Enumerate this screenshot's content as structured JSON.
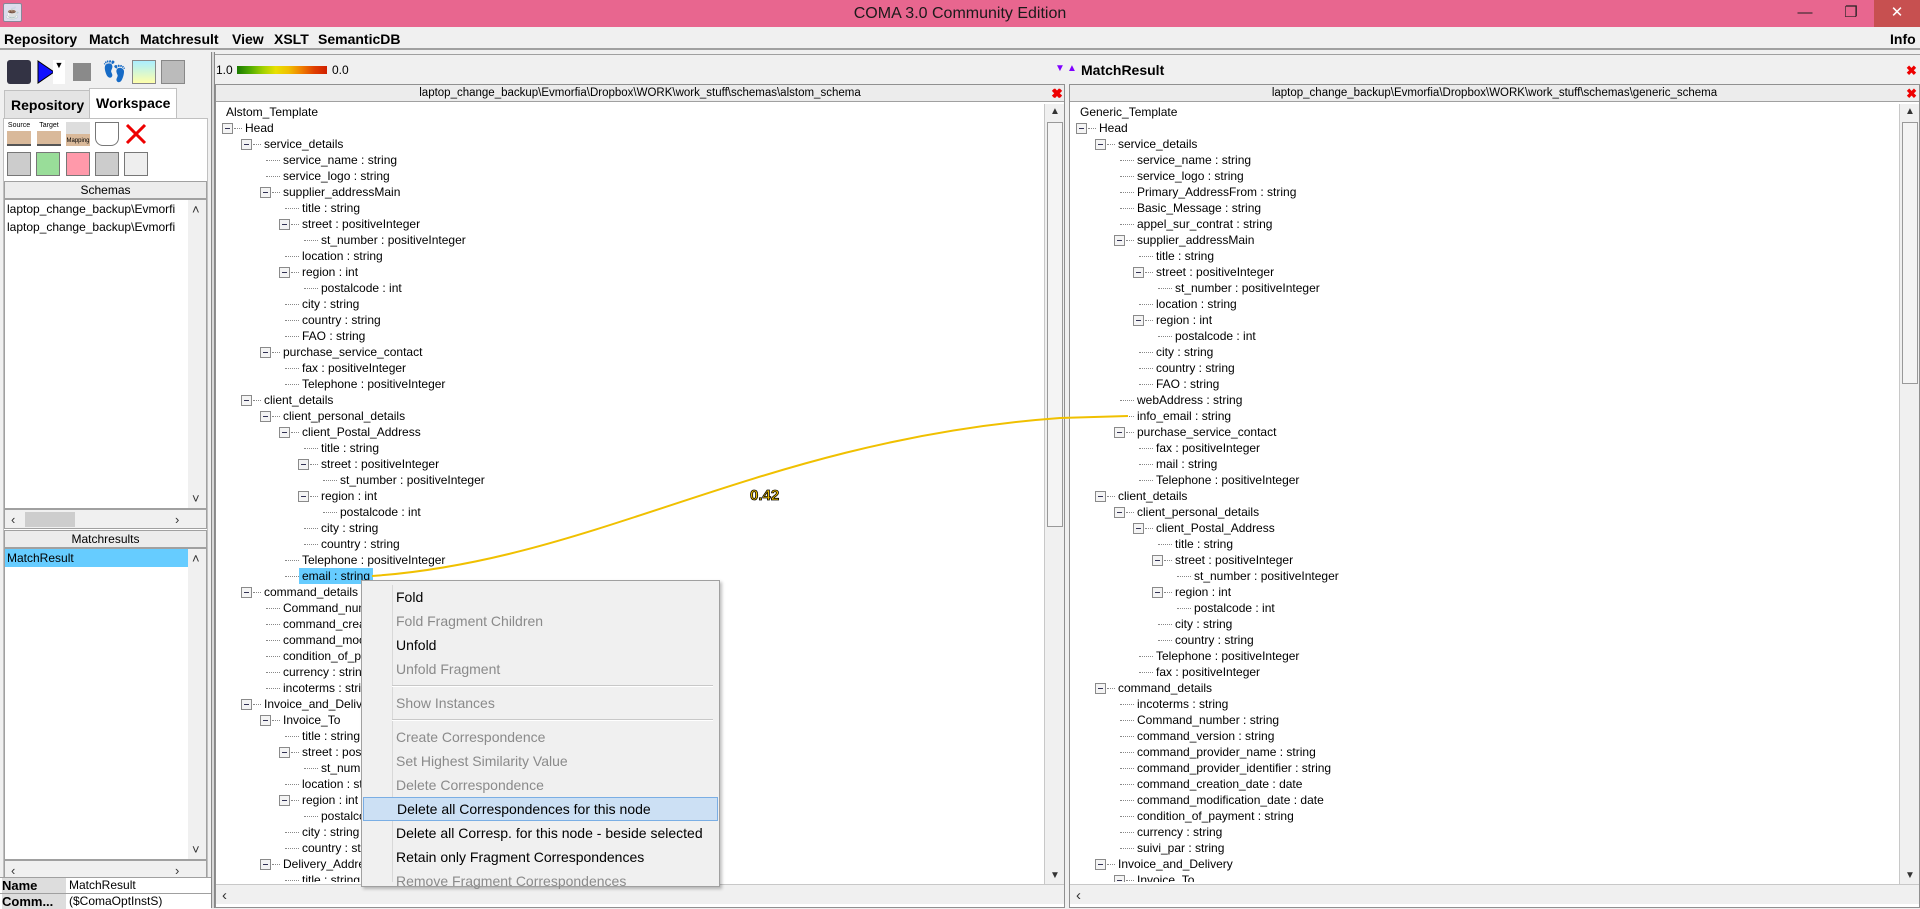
{
  "window": {
    "title": "COMA 3.0 Community Edition",
    "minimize": "—",
    "maximize": "❐",
    "close": "✕"
  },
  "menubar": {
    "items": [
      "Repository",
      "Match",
      "Matchresult",
      "View",
      "XSLT",
      "SemanticDB"
    ],
    "info": "Info"
  },
  "toolbar": {
    "icons": [
      "repository-icon",
      "match-run-icon",
      "dropdown-icon",
      "stop-icon",
      "footsteps-icon",
      "merge-schemas-icon",
      "merge-disabled-icon"
    ]
  },
  "tabs": {
    "repository": "Repository",
    "workspace": "Workspace",
    "active": "Workspace"
  },
  "workspace_tools": {
    "source": "Source",
    "target": "Target",
    "mapping": "Mapping"
  },
  "schemas": {
    "header": "Schemas",
    "items": [
      "laptop_change_backup\\Evmorfi",
      "laptop_change_backup\\Evmorfi"
    ]
  },
  "matchresults": {
    "header": "Matchresults",
    "items": [
      "MatchResult"
    ],
    "selected": "MatchResult"
  },
  "properties": {
    "rows": [
      {
        "key": "Name",
        "value": "MatchResult"
      },
      {
        "key": "Comm...",
        "value": "($ComaOptInstS)"
      }
    ]
  },
  "similarity_scale": {
    "max": "1.0",
    "min": "0.0",
    "colors": [
      "#1a7a00",
      "#a0d000",
      "#e8e000",
      "#f08000",
      "#d02000"
    ]
  },
  "matchresult_header": {
    "title": "MatchResult"
  },
  "source_schema": {
    "path": "laptop_change_backup\\Evmorfia\\Dropbox\\WORK\\work_stuff\\schemas\\alstom_schema",
    "root": "Alstom_Template",
    "nodes": [
      [
        1,
        "Head",
        1
      ],
      [
        2,
        "service_details",
        1
      ],
      [
        3,
        "service_name : string",
        0
      ],
      [
        3,
        "service_logo : string",
        0
      ],
      [
        3,
        "supplier_addressMain",
        1
      ],
      [
        4,
        "title : string",
        0
      ],
      [
        4,
        "street : positiveInteger",
        1
      ],
      [
        5,
        "st_number : positiveInteger",
        0
      ],
      [
        4,
        "location : string",
        0
      ],
      [
        4,
        "region : int",
        1
      ],
      [
        5,
        "postalcode : int",
        0
      ],
      [
        4,
        "city : string",
        0
      ],
      [
        4,
        "country : string",
        0
      ],
      [
        4,
        "FAO : string",
        0
      ],
      [
        3,
        "purchase_service_contact",
        1
      ],
      [
        4,
        "fax : positiveInteger",
        0
      ],
      [
        4,
        "Telephone : positiveInteger",
        0
      ],
      [
        2,
        "client_details",
        1
      ],
      [
        3,
        "client_personal_details",
        1
      ],
      [
        4,
        "client_Postal_Address",
        1
      ],
      [
        5,
        "title : string",
        0
      ],
      [
        5,
        "street : positiveInteger",
        1
      ],
      [
        6,
        "st_number : positiveInteger",
        0
      ],
      [
        5,
        "region : int",
        1
      ],
      [
        6,
        "postalcode : int",
        0
      ],
      [
        5,
        "city : string",
        0
      ],
      [
        5,
        "country : string",
        0
      ],
      [
        4,
        "Telephone : positiveInteger",
        0
      ],
      [
        4,
        "email : string",
        0
      ],
      [
        2,
        "command_details",
        1
      ],
      [
        3,
        "Command_num",
        0
      ],
      [
        3,
        "command_crea",
        0
      ],
      [
        3,
        "command_moc",
        0
      ],
      [
        3,
        "condition_of_pa",
        0
      ],
      [
        3,
        "currency : string",
        0
      ],
      [
        3,
        "incoterms : strin",
        0
      ],
      [
        2,
        "Invoice_and_Delive",
        1
      ],
      [
        3,
        "Invoice_To",
        1
      ],
      [
        4,
        "title : string",
        0
      ],
      [
        4,
        "street : posit",
        1
      ],
      [
        5,
        "st_numb",
        0
      ],
      [
        4,
        "location : str",
        0
      ],
      [
        4,
        "region : int",
        1
      ],
      [
        5,
        "postalco",
        0
      ],
      [
        4,
        "city : string",
        0
      ],
      [
        4,
        "country : strir",
        0
      ],
      [
        3,
        "Delivery_Addres",
        1
      ],
      [
        4,
        "title : string",
        0
      ]
    ],
    "selected": "email : string"
  },
  "target_schema": {
    "path": "laptop_change_backup\\Evmorfia\\Dropbox\\WORK\\work_stuff\\schemas\\generic_schema",
    "root": "Generic_Template",
    "nodes": [
      [
        1,
        "Head",
        1
      ],
      [
        2,
        "service_details",
        1
      ],
      [
        3,
        "service_name : string",
        0
      ],
      [
        3,
        "service_logo : string",
        0
      ],
      [
        3,
        "Primary_AddressFrom : string",
        0
      ],
      [
        3,
        "Basic_Message : string",
        0
      ],
      [
        3,
        "appel_sur_contrat : string",
        0
      ],
      [
        3,
        "supplier_addressMain",
        1
      ],
      [
        4,
        "title : string",
        0
      ],
      [
        4,
        "street : positiveInteger",
        1
      ],
      [
        5,
        "st_number : positiveInteger",
        0
      ],
      [
        4,
        "location : string",
        0
      ],
      [
        4,
        "region : int",
        1
      ],
      [
        5,
        "postalcode : int",
        0
      ],
      [
        4,
        "city : string",
        0
      ],
      [
        4,
        "country : string",
        0
      ],
      [
        4,
        "FAO : string",
        0
      ],
      [
        3,
        "webAddress : string",
        0
      ],
      [
        3,
        "info_email : string",
        0
      ],
      [
        3,
        "purchase_service_contact",
        1
      ],
      [
        4,
        "fax : positiveInteger",
        0
      ],
      [
        4,
        "mail : string",
        0
      ],
      [
        4,
        "Telephone : positiveInteger",
        0
      ],
      [
        2,
        "client_details",
        1
      ],
      [
        3,
        "client_personal_details",
        1
      ],
      [
        4,
        "client_Postal_Address",
        1
      ],
      [
        5,
        "title : string",
        0
      ],
      [
        5,
        "street : positiveInteger",
        1
      ],
      [
        6,
        "st_number : positiveInteger",
        0
      ],
      [
        5,
        "region : int",
        1
      ],
      [
        6,
        "postalcode : int",
        0
      ],
      [
        5,
        "city : string",
        0
      ],
      [
        5,
        "country : string",
        0
      ],
      [
        4,
        "Telephone : positiveInteger",
        0
      ],
      [
        4,
        "fax : positiveInteger",
        0
      ],
      [
        2,
        "command_details",
        1
      ],
      [
        3,
        "incoterms : string",
        0
      ],
      [
        3,
        "Command_number : string",
        0
      ],
      [
        3,
        "command_version : string",
        0
      ],
      [
        3,
        "command_provider_name : string",
        0
      ],
      [
        3,
        "command_provider_identifier : string",
        0
      ],
      [
        3,
        "command_creation_date : date",
        0
      ],
      [
        3,
        "command_modification_date : date",
        0
      ],
      [
        3,
        "condition_of_payment : string",
        0
      ],
      [
        3,
        "currency : string",
        0
      ],
      [
        3,
        "suivi_par : string",
        0
      ],
      [
        2,
        "Invoice_and_Delivery",
        1
      ],
      [
        3,
        "Invoice_To",
        1
      ]
    ]
  },
  "correspondence": {
    "source": "email : string",
    "target": "info_email : string",
    "similarity": "0.42",
    "color": "#f0c000"
  },
  "context_menu": {
    "items": [
      {
        "label": "Fold",
        "enabled": true
      },
      {
        "label": "Fold Fragment Children",
        "enabled": false
      },
      {
        "label": "Unfold",
        "enabled": true
      },
      {
        "label": "Unfold Fragment",
        "enabled": false
      },
      {
        "separator": true
      },
      {
        "label": "Show Instances",
        "enabled": false
      },
      {
        "separator": true
      },
      {
        "label": "Create Correspondence",
        "enabled": false
      },
      {
        "label": "Set Highest Similarity Value",
        "enabled": false
      },
      {
        "label": "Delete Correspondence",
        "enabled": false
      },
      {
        "label": "Delete all Correspondences for this node",
        "enabled": true,
        "highlighted": true
      },
      {
        "label": "Delete all Corresp. for this node - beside selected",
        "enabled": true
      },
      {
        "label": "Retain only Fragment Correspondences",
        "enabled": true
      },
      {
        "label": "Remove Fragment Correspondences",
        "enabled": false
      }
    ]
  }
}
